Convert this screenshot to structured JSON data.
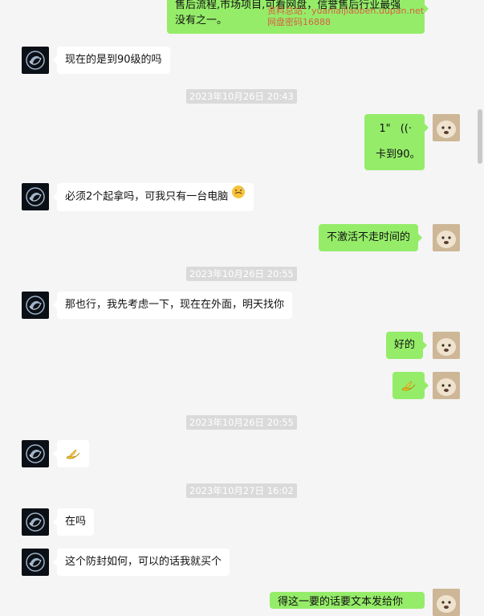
{
  "colors": {
    "background": "#f5f5f5",
    "self_bubble": "#95ec69",
    "other_bubble": "#ffffff",
    "timestamp_bg": "#dadada"
  },
  "top_message": {
    "line1": "售后流程,市场项目,可看网盘，信誉售后行业最强",
    "line2": "没有之一。"
  },
  "watermark": {
    "line1": "资料总站：yuanlaijiaoben.uupan.net",
    "line2": "网盘密码16888"
  },
  "messages": [
    {
      "text": "现在的是到90级的吗"
    },
    {
      "timestamp": "2023年10月26日 20:43"
    },
    {
      "voice_duration": "1\"",
      "text": "卡到90。"
    },
    {
      "text": "必须2个起拿吗，可我只有一台电脑",
      "emoji": "cold-sweat-emoji"
    },
    {
      "text": "不激活不走时间的"
    },
    {
      "timestamp": "2023年10月26日 20:55"
    },
    {
      "text": "那也行，我先考虑一下，现在在外面，明天找你"
    },
    {
      "text": "好的"
    },
    {
      "emoji": "banana-emoji"
    },
    {
      "timestamp": "2023年10月26日 20:55"
    },
    {
      "emoji": "banana-emoji"
    },
    {
      "timestamp": "2023年10月27日 16:02"
    },
    {
      "text": "在吗"
    },
    {
      "text": "这个防封如何，可以的话我就买个"
    },
    {
      "text": "得这一要的话要文本发给你"
    }
  ]
}
